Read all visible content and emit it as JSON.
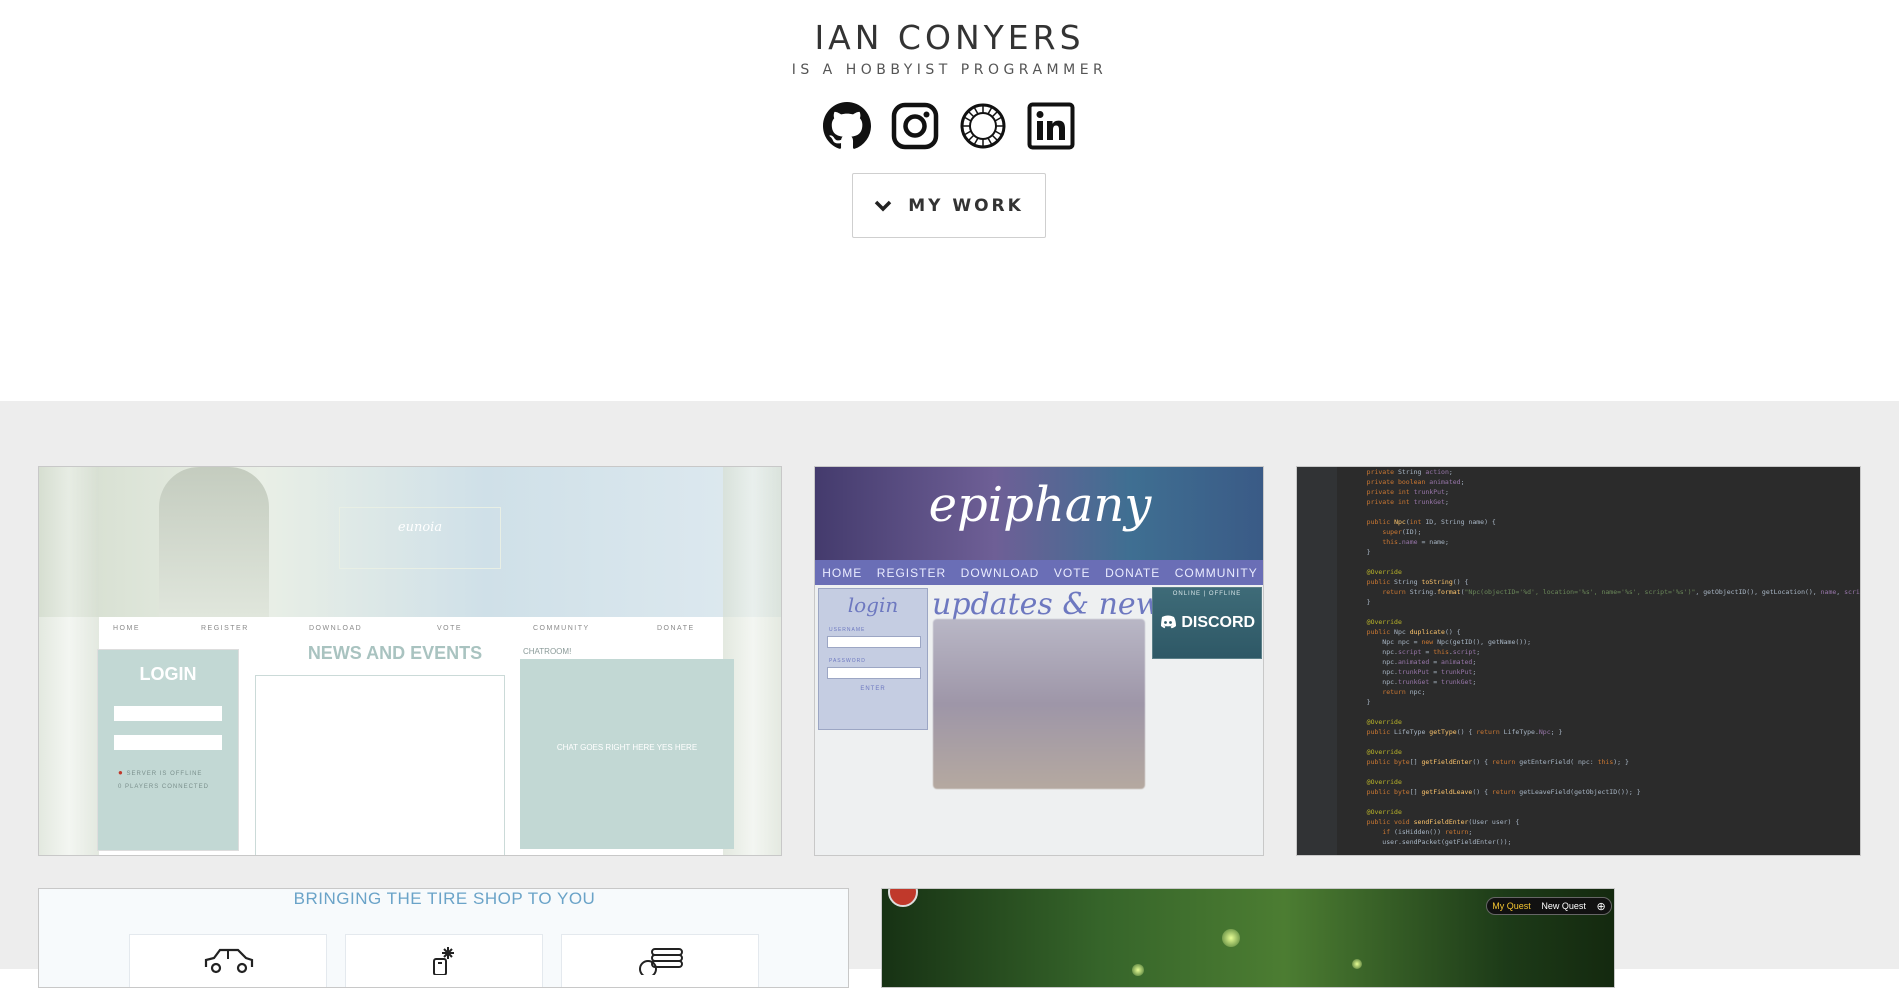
{
  "header": {
    "name": "IAN CONYERS",
    "tagline": "IS A HOBBYIST PROGRAMMER",
    "socials": [
      {
        "icon": "github-icon"
      },
      {
        "icon": "instagram-icon"
      },
      {
        "icon": "vsco-icon"
      },
      {
        "icon": "linkedin-icon"
      }
    ],
    "work_button": {
      "label": "MY WORK",
      "icon": "chevron-down-icon"
    }
  },
  "gallery": {
    "background": "#ededed",
    "projects": [
      {
        "id": "project-1",
        "logo": "eunoia",
        "menu": [
          "HOME",
          "REGISTER",
          "DOWNLOAD",
          "VOTE",
          "COMMUNITY",
          "DONATE"
        ],
        "login_title": "LOGIN",
        "server_status": "SERVER IS OFFLINE",
        "players": "0 PLAYERS CONNECTED",
        "news_title": "NEWS AND EVENTS",
        "chat_title": "CHATROOM!",
        "chat_text": "CHAT GOES RIGHT HERE YES HERE"
      },
      {
        "id": "project-2",
        "logo": "epiphany",
        "nav": [
          "HOME",
          "REGISTER",
          "DOWNLOAD",
          "VOTE",
          "DONATE",
          "COMMUNITY"
        ],
        "login_title": "login",
        "username_label": "USERNAME",
        "password_label": "PASSWORD",
        "enter_label": "ENTER",
        "updates_title": "updates & news",
        "server_status": "ONLINE | OFFLINE",
        "discord_label": "DISCORD"
      },
      {
        "id": "project-3",
        "kind": "code-editor-screenshot"
      },
      {
        "id": "project-4",
        "headline": "BRINGING THE TIRE SHOP TO YOU",
        "features": [
          {
            "icon": "car-icon"
          },
          {
            "icon": "tire-service-icon"
          },
          {
            "icon": "tire-stack-icon"
          }
        ]
      },
      {
        "id": "project-5",
        "quest_tabs": [
          "My Quest",
          "New Quest"
        ]
      }
    ]
  }
}
